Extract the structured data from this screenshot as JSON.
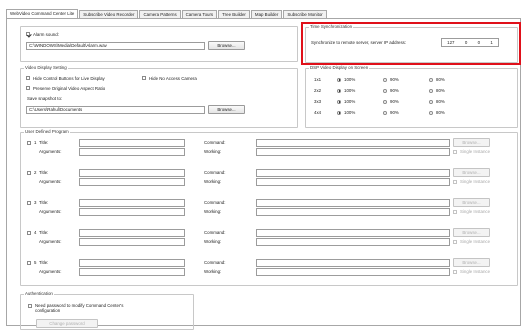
{
  "tabs": [
    {
      "label": "WebVideo Command Center Lite",
      "active": true
    },
    {
      "label": "Subscribe Video Recorder"
    },
    {
      "label": "Camera Patterns"
    },
    {
      "label": "Camera Tours"
    },
    {
      "label": "Tree Builder"
    },
    {
      "label": "Map Builder"
    },
    {
      "label": "Subscribe Monitor"
    }
  ],
  "alarm": {
    "checkbox_label": "Alarm sound:",
    "checked": true,
    "path_value": "C:\\WINDOWS\\Media\\Default\\Alarm.wav",
    "browse_label": "Browse..."
  },
  "time_sync": {
    "title": "Time Synchronization",
    "label": "Synchronize to remote server, server IP address:",
    "ip": [
      "127",
      "0",
      "0",
      "1"
    ],
    "highlight_color": "#e0101a"
  },
  "video_display": {
    "title": "Video Display Setting",
    "hide_control_buttons": "Hide Control Buttons for Live Display",
    "hide_no_access": "Hide No Access Camera",
    "preserve_aspect": "Preserve Original Video Aspect Ratio",
    "save_snapshot_label": "Save snapshot to:",
    "snapshot_path": "C:\\Users\\Rahul\\Documents",
    "browse_label": "Browse..."
  },
  "dsp": {
    "title": "DSP Video Display on Screen",
    "rows": [
      {
        "label": "1x1",
        "options": [
          "100%",
          "90%",
          "80%"
        ],
        "selected": 0
      },
      {
        "label": "2x2",
        "options": [
          "100%",
          "90%",
          "80%"
        ],
        "selected": 0
      },
      {
        "label": "3x3",
        "options": [
          "100%",
          "90%",
          "80%"
        ],
        "selected": 0
      },
      {
        "label": "4x4",
        "options": [
          "100%",
          "90%",
          "80%"
        ],
        "selected": 0
      }
    ]
  },
  "programs": {
    "title": "User Defined Program",
    "title_label": "Title:",
    "arguments_label": "Arguments:",
    "command_label": "Command:",
    "working_label": "Working:",
    "browse_label": "Browse...",
    "single_instance_label": "Single Instance",
    "items": [
      {
        "number": "1"
      },
      {
        "number": "2"
      },
      {
        "number": "3"
      },
      {
        "number": "4"
      },
      {
        "number": "5"
      }
    ]
  },
  "auth": {
    "title": "Authentication",
    "need_password": "Need password to modify Command Center's configuration",
    "change_password": "Change password"
  }
}
